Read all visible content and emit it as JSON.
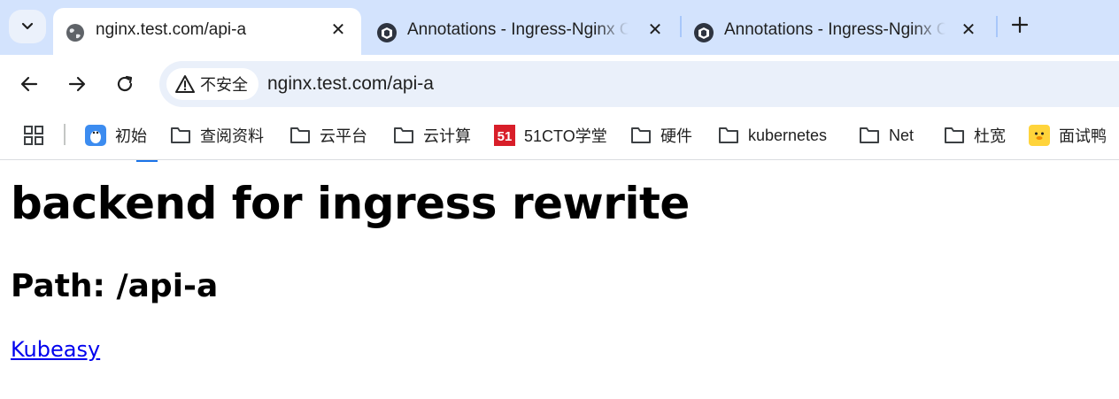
{
  "tabs": [
    {
      "title": "nginx.test.com/api-a",
      "icon": "globe-icon",
      "active": true
    },
    {
      "title": "Annotations - Ingress-Nginx Controller",
      "icon": "ingress-nginx-logo-icon",
      "active": false
    },
    {
      "title": "Annotations - Ingress-Nginx Controller",
      "icon": "ingress-nginx-logo-icon",
      "active": false
    }
  ],
  "toolbar": {
    "security_label": "不安全",
    "url": "nginx.test.com/api-a"
  },
  "bookmarks": [
    {
      "label": "初始",
      "icon": "penguin-app-icon"
    },
    {
      "label": "查阅资料",
      "icon": "folder-icon"
    },
    {
      "label": "云平台",
      "icon": "folder-icon"
    },
    {
      "label": "云计算",
      "icon": "folder-icon"
    },
    {
      "label": "51CTO学堂",
      "icon": "51cto-logo-icon"
    },
    {
      "label": "硬件",
      "icon": "folder-icon"
    },
    {
      "label": "kubernetes",
      "icon": "folder-icon"
    },
    {
      "label": "Net",
      "icon": "folder-icon"
    },
    {
      "label": "杜宽",
      "icon": "folder-icon"
    },
    {
      "label": "面试鸭",
      "icon": "duck-icon"
    }
  ],
  "page": {
    "heading": "backend for ingress rewrite",
    "subheading": "Path: /api-a",
    "link_text": "Kubeasy"
  },
  "colors": {
    "tabstrip": "#d3e3fd",
    "omnibox": "#eaf0fa",
    "link": "#0000ee"
  }
}
